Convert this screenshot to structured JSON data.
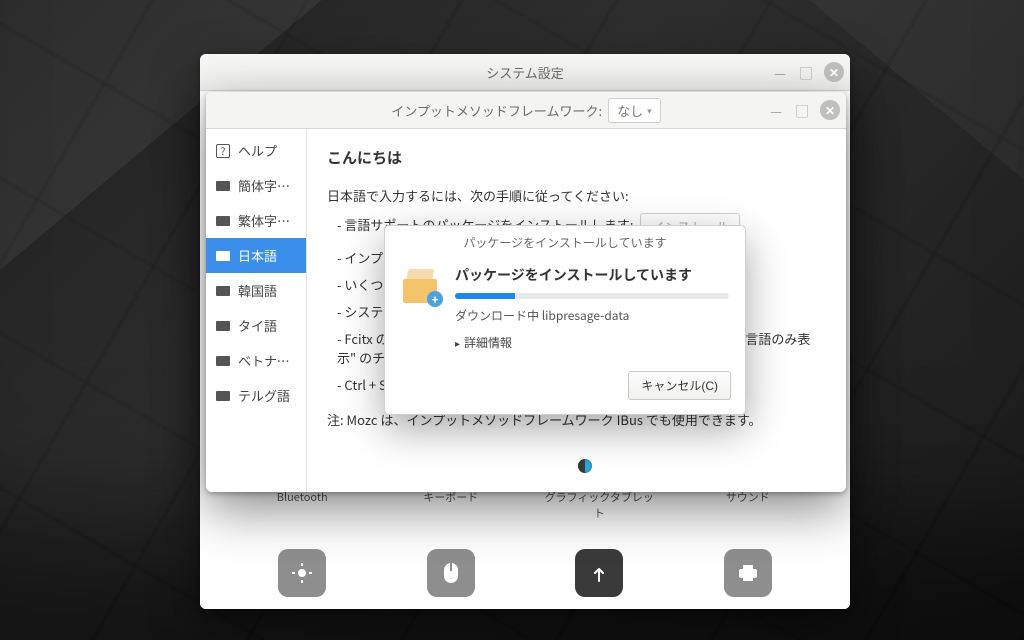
{
  "outer_window": {
    "title": "システム設定",
    "icons_upper": [
      {
        "label": "Bluetooth",
        "color": "blue",
        "glyph": "bt"
      },
      {
        "label": "キーボード",
        "color": "gray",
        "glyph": "kbd"
      },
      {
        "label": "グラフィックタブレット",
        "color": "gray",
        "glyph": "tablet"
      },
      {
        "label": "サウンド",
        "color": "gray",
        "glyph": "sound"
      }
    ],
    "icons_lower_count": 4
  },
  "im_window": {
    "framework_label": "インプットメソッドフレームワーク:",
    "framework_value": "なし",
    "sidebar": [
      {
        "kind": "help",
        "label": "ヘルプ"
      },
      {
        "kind": "lang",
        "label": "簡体字中国語"
      },
      {
        "kind": "lang",
        "label": "繁体字中国語"
      },
      {
        "kind": "lang",
        "label": "日本語",
        "selected": true
      },
      {
        "kind": "lang",
        "label": "韓国語"
      },
      {
        "kind": "lang",
        "label": "タイ語"
      },
      {
        "kind": "lang",
        "label": "ベトナム語"
      },
      {
        "kind": "lang",
        "label": "テルグ語"
      }
    ],
    "content": {
      "heading": "こんにちは",
      "intro": "日本語で入力するには、次の手順に従ってください:",
      "step_install_prefix": "- 言語サポートのパッケージをインストールします:",
      "install_button": "インストール",
      "step_im": "- インプットメソッドフレームワークを選択してください",
      "step_cfg": "- いくつかの設定を行ってください",
      "step_sys": "- システムを再起動してください",
      "step_fcitx": "- Fcitx の設定を開き、\"入力メソッド\" タブで \"+\" をクリック、\"現在の言語のみ表示\" のチェックを外してください",
      "step_ctrl": "- Ctrl + Space で入力メソッドを切り替えます",
      "note": "注: Mozc は、インプットメソッドフレームワーク IBus でも使用できます。"
    }
  },
  "dialog": {
    "title": "パッケージをインストールしています",
    "heading": "パッケージをインストールしています",
    "progress_percent": 22,
    "download_text": "ダウンロード中 libpresage-data",
    "details_label": "詳細情報",
    "cancel_label": "キャンセル(C)"
  },
  "glyphs": {
    "min": "—",
    "max": "▢",
    "close": "✕",
    "chevron": "▾",
    "tri_right": "▸",
    "plus": "+"
  }
}
